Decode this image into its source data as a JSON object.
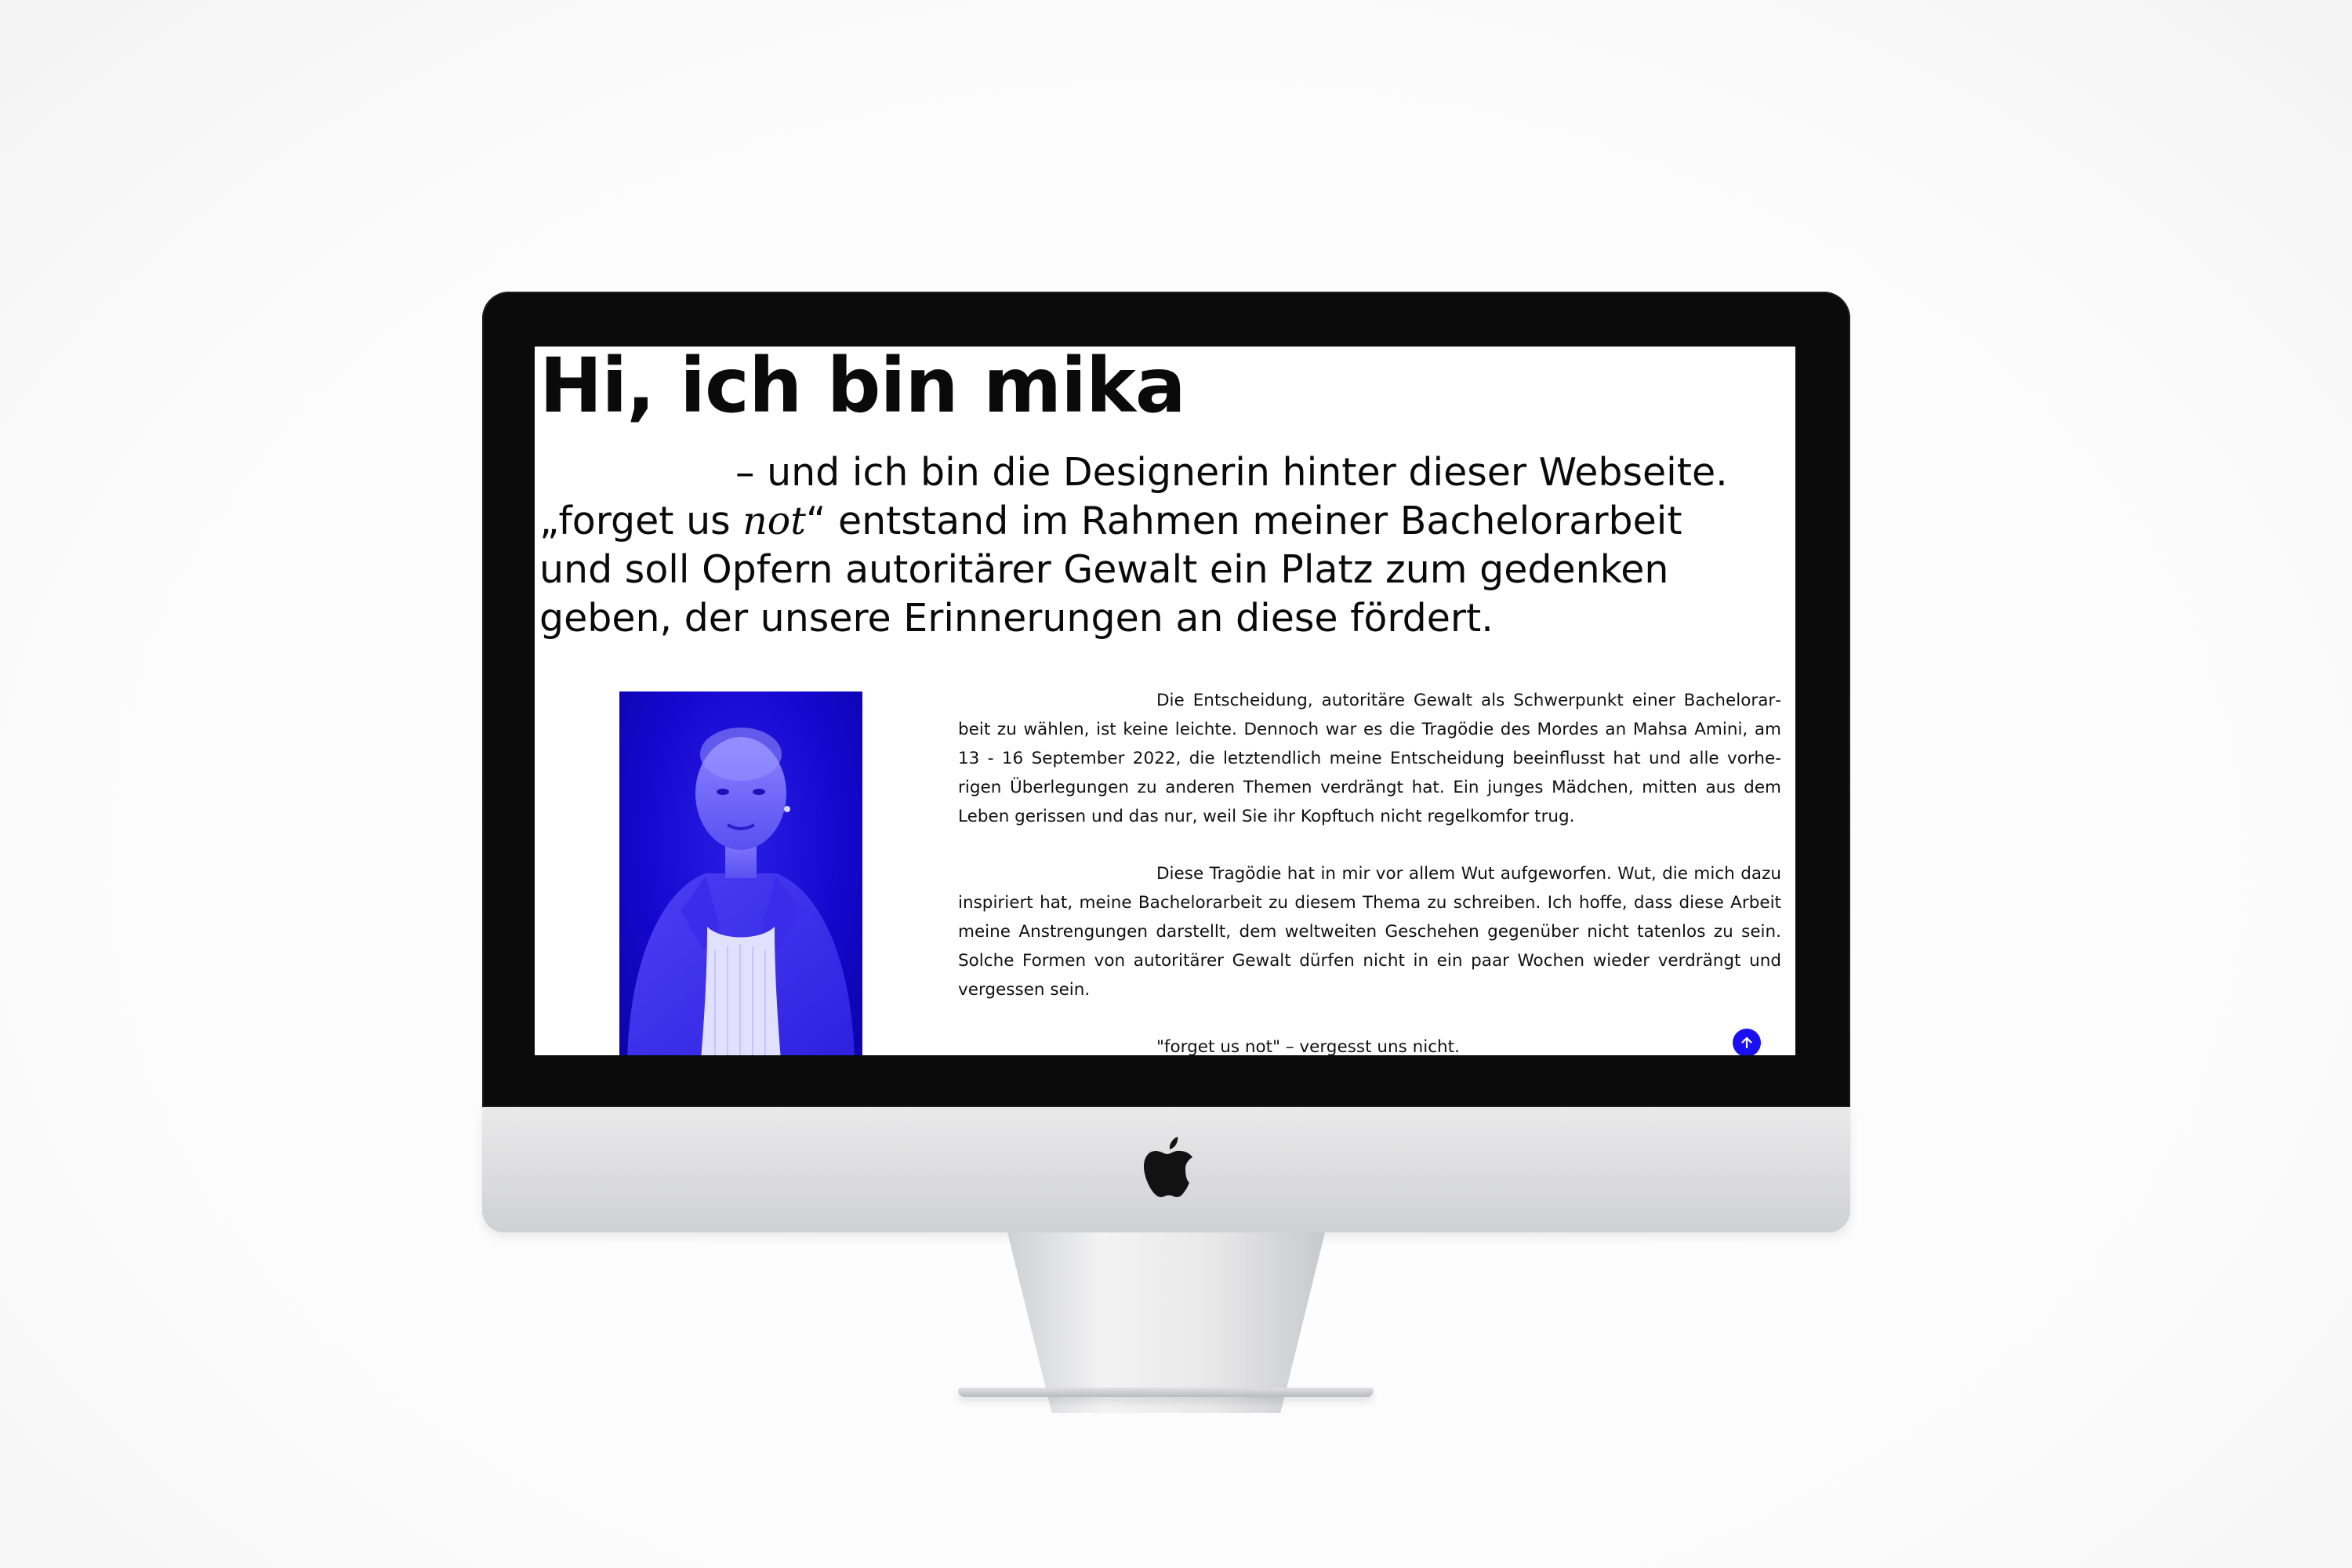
{
  "page": {
    "title": "Hi, ich bin mika",
    "intro": {
      "line1": "– und ich bin die Designerin hinter dieser Webseite.",
      "line2_pre": "„forget us ",
      "line2_italic": "not",
      "line2_post": "“ entstand im Rahmen meiner Bachelorarbeit",
      "line3": "und soll Opfern autoritärer Gewalt ein Platz zum gedenken",
      "line4": "geben, der unsere Erinnerungen an diese fördert."
    },
    "paragraphs": [
      "Die Entscheidung, autoritäre Gewalt als Schwerpunkt einer Bachelorar­beit zu wählen, ist keine leichte. Dennoch war es die Tragödie des Mordes an Mahsa Amini, am 13 - 16 September 2022, die letztendlich meine Entscheidung beeinflusst hat und alle vorhe­rigen Überlegungen zu anderen Themen verdrängt hat. Ein junges Mädchen, mitten aus dem Leben gerissen und das nur, weil Sie ihr Kopftuch nicht regelkomfor trug.",
      "Diese Tragödie hat in mir vor allem Wut aufgeworfen. Wut, die mich dazu inspiriert hat, meine Bachelorarbeit zu diesem Thema zu schreiben. Ich hoffe, dass diese Arbeit meine Anstrengungen darstellt, dem weltweiten Geschehen gegenüber nicht tatenlos zu sein. Solche Formen von autoritärer Gewalt dürfen nicht in ein paar Wochen wieder verdrängt und vergessen sein.",
      "\"forget us not\" – vergesst uns nicht."
    ],
    "scroll_top_icon": "arrow-up-icon",
    "accent_color": "#1a0ff0",
    "portrait_tint": "#1506cc"
  },
  "device": {
    "logo_icon": "apple-logo-icon"
  }
}
